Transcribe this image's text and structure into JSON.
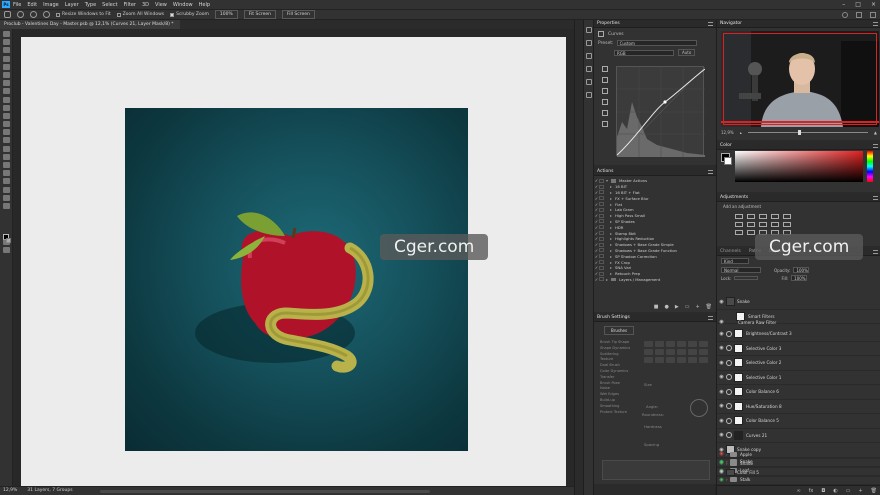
{
  "menubar": {
    "logo": "Ps",
    "items": [
      "File",
      "Edit",
      "Image",
      "Layer",
      "Type",
      "Select",
      "Filter",
      "3D",
      "View",
      "Window",
      "Help"
    ]
  },
  "options": {
    "resize_windows": "Resize Windows to Fit",
    "zoom_all": "Zoom All Windows",
    "scrubby_zoom": "Scrubby Zoom",
    "zoom_pct": "100%",
    "fit_screen": "Fit Screen",
    "fill_screen": "Fill Screen"
  },
  "document": {
    "tab_title": "Proclub - Valentines Day - Master.psb @ 12,1% (Curves 21, Layer Mask/8) *"
  },
  "status": {
    "zoom": "12,9%",
    "info": "31 Layers, 7 Groups"
  },
  "properties": {
    "tabs": [
      "Properties",
      "Actions"
    ],
    "panel_label": "Curves",
    "preset_label": "Preset:",
    "preset_value": "Custom",
    "channel_value": "RGB",
    "auto_label": "Auto"
  },
  "actions": {
    "title": "Actions",
    "items": [
      "Master Actions",
      "16 BIT",
      "16 BIT + Flat",
      "FX + Surface Blur",
      "Flat",
      "Lab Gram",
      "High Pass Small",
      "SP Shades",
      "HDR",
      "Stamp 8bit",
      "Highlights Reduction",
      "Shadows + Base Grade Simple",
      "Shadows + Base Grade Function",
      "SP Shadow Correction",
      "FX Crop",
      "SNA Vari",
      "Retouch Prep",
      "Layers / Management"
    ]
  },
  "brush_settings": {
    "title": "Brush Settings",
    "brushes_button": "Brushes",
    "options": [
      "Brush Tip Shape",
      "Shape Dynamics",
      "Scattering",
      "Texture",
      "Dual Brush",
      "Color Dynamics",
      "Transfer",
      "Brush Pose",
      "Noise",
      "Wet Edges",
      "Build-up",
      "Smoothing",
      "Protect Texture"
    ],
    "size_label": "Size",
    "angle_label": "Angle:",
    "roundness_label": "Roundness:",
    "hardness_label": "Hardness",
    "spacing_label": "Spacing"
  },
  "navigator": {
    "title": "Navigator",
    "zoom": "12,9%"
  },
  "color": {
    "title": "Color"
  },
  "adjustments": {
    "title": "Adjustments",
    "subtitle": "Add an adjustment"
  },
  "layers": {
    "tabs": [
      "Channels",
      "Paths",
      "Layers"
    ],
    "kind_label": "Kind",
    "blend_mode": "Normal",
    "opacity_label": "Opacity:",
    "opacity_value": "100%",
    "lock_label": "Lock:",
    "fill_label": "Fill:",
    "fill_value": "100%",
    "items": [
      {
        "name": "Snake",
        "kind": "smart"
      },
      {
        "name": "Smart Filters",
        "kind": "sub"
      },
      {
        "name": "Camera Raw Filter",
        "kind": "sub"
      },
      {
        "name": "Brightness/Contrast 3",
        "kind": "adj"
      },
      {
        "name": "Selective Color 3",
        "kind": "adj"
      },
      {
        "name": "Selective Color 2",
        "kind": "adj"
      },
      {
        "name": "Selective Color 1",
        "kind": "adj"
      },
      {
        "name": "Color Balance 6",
        "kind": "adj"
      },
      {
        "name": "Hue/Saturation 8",
        "kind": "adj"
      },
      {
        "name": "Color Balance 5",
        "kind": "adj"
      },
      {
        "name": "Curves 21",
        "kind": "adj"
      },
      {
        "name": "Snake copy",
        "kind": "layer"
      },
      {
        "name": "Snake",
        "kind": "group"
      },
      {
        "name": "Leaf",
        "kind": "group"
      },
      {
        "name": "Stalk",
        "kind": "group"
      },
      {
        "name": "Apple",
        "kind": "group"
      },
      {
        "name": "Shade",
        "kind": "group"
      },
      {
        "name": "Color Fill 5",
        "kind": "layer"
      }
    ]
  },
  "watermark": "Cger.com",
  "colors": {
    "accent": "#31a8ff",
    "panel": "#323232",
    "frame": "#e02020"
  }
}
